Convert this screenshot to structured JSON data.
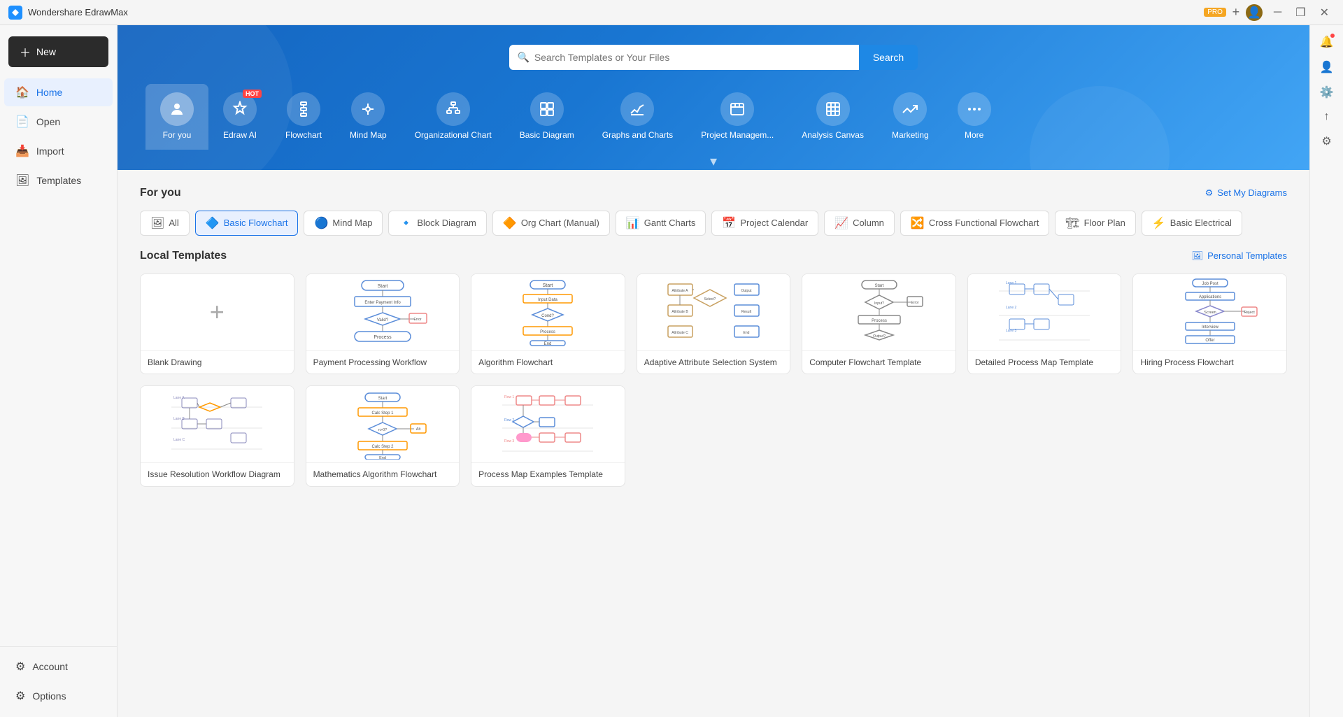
{
  "titlebar": {
    "app_name": "Wondershare EdrawMax",
    "pro_label": "PRO",
    "new_tab_btn": "+"
  },
  "top_icons": {
    "bell": "🔔",
    "account": "👤",
    "apps": "⚙️",
    "share": "↑",
    "settings": "⚙"
  },
  "sidebar": {
    "new_btn": "New",
    "items": [
      {
        "id": "home",
        "label": "Home",
        "active": true
      },
      {
        "id": "open",
        "label": "Open"
      },
      {
        "id": "import",
        "label": "Import"
      },
      {
        "id": "templates",
        "label": "Templates"
      }
    ],
    "bottom": {
      "account": "Account",
      "options": "Options"
    }
  },
  "hero": {
    "search_placeholder": "Search Templates or Your Files",
    "search_btn": "Search",
    "categories": [
      {
        "id": "for-you",
        "label": "For you",
        "active": true
      },
      {
        "id": "edraw-ai",
        "label": "Edraw AI",
        "hot": true
      },
      {
        "id": "flowchart",
        "label": "Flowchart"
      },
      {
        "id": "mind-map",
        "label": "Mind Map"
      },
      {
        "id": "org-chart",
        "label": "Organizational Chart"
      },
      {
        "id": "basic-diagram",
        "label": "Basic Diagram"
      },
      {
        "id": "graphs",
        "label": "Graphs and Charts"
      },
      {
        "id": "project",
        "label": "Project Managem..."
      },
      {
        "id": "analysis",
        "label": "Analysis Canvas"
      },
      {
        "id": "marketing",
        "label": "Marketing"
      },
      {
        "id": "more",
        "label": "More"
      }
    ]
  },
  "for_you": {
    "section_title": "For you",
    "action_label": "Set My Diagrams",
    "filters": [
      {
        "id": "all",
        "label": "All"
      },
      {
        "id": "basic-flowchart",
        "label": "Basic Flowchart",
        "active": true
      },
      {
        "id": "mind-map",
        "label": "Mind Map"
      },
      {
        "id": "block-diagram",
        "label": "Block Diagram"
      },
      {
        "id": "org-chart",
        "label": "Org Chart (Manual)"
      },
      {
        "id": "gantt",
        "label": "Gantt Charts"
      },
      {
        "id": "project-cal",
        "label": "Project Calendar"
      },
      {
        "id": "column",
        "label": "Column"
      },
      {
        "id": "cross-func",
        "label": "Cross Functional Flowchart"
      },
      {
        "id": "floor-plan",
        "label": "Floor Plan"
      },
      {
        "id": "basic-elec",
        "label": "Basic Electrical"
      }
    ]
  },
  "local_templates": {
    "section_title": "Local Templates",
    "action_label": "Personal Templates",
    "items": [
      {
        "id": "blank",
        "label": "Blank Drawing",
        "blank": true
      },
      {
        "id": "payment",
        "label": "Payment Processing Workflow"
      },
      {
        "id": "algorithm",
        "label": "Algorithm Flowchart"
      },
      {
        "id": "adaptive",
        "label": "Adaptive Attribute Selection System"
      },
      {
        "id": "computer",
        "label": "Computer Flowchart Template"
      },
      {
        "id": "detailed",
        "label": "Detailed Process Map Template"
      },
      {
        "id": "hiring",
        "label": "Hiring Process Flowchart"
      },
      {
        "id": "issue",
        "label": "Issue Resolution Workflow Diagram"
      },
      {
        "id": "math",
        "label": "Mathematics Algorithm Flowchart"
      },
      {
        "id": "process-map",
        "label": "Process Map Examples Template"
      }
    ]
  }
}
